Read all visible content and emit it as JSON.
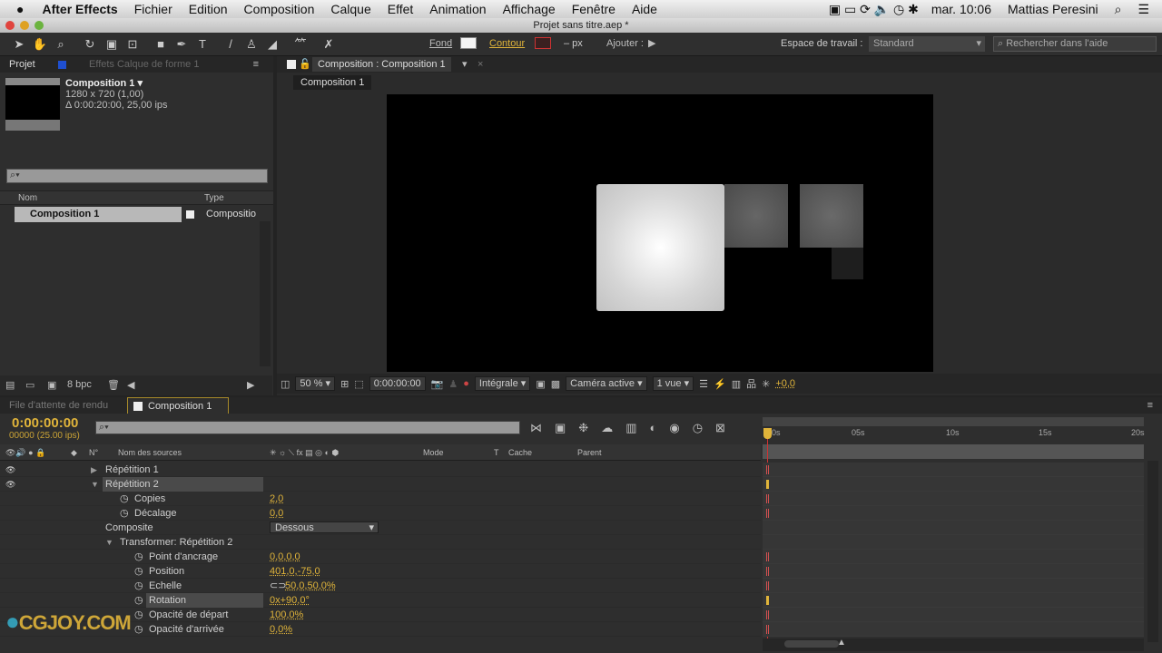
{
  "menubar": {
    "app": "After Effects",
    "items": [
      "Fichier",
      "Edition",
      "Composition",
      "Calque",
      "Effet",
      "Animation",
      "Affichage",
      "Fenêtre",
      "Aide"
    ],
    "clock": "mar. 10:06",
    "user": "Mattias Peresini"
  },
  "window": {
    "title": "Projet sans titre.aep *"
  },
  "toolbar": {
    "fond": "Fond",
    "contour": "Contour",
    "px": "– px",
    "ajouter": "Ajouter :",
    "workspace_label": "Espace de travail :",
    "workspace": "Standard",
    "help_placeholder": "Rechercher dans l'aide"
  },
  "project": {
    "tab": "Projet",
    "effects_tab": "Effets Calque de forme 1",
    "comp_name": "Composition 1 ▾",
    "comp_size": "1280 x 720 (1,00)",
    "comp_duration": "Δ 0:00:20:00, 25,00 ips",
    "col_name": "Nom",
    "col_type": "Type",
    "items": [
      {
        "name": "Composition 1",
        "type": "Compositio"
      }
    ],
    "bpc": "8 bpc"
  },
  "viewer": {
    "tab": "Composition : Composition 1",
    "breadcrumb": "Composition 1",
    "zoom": "50 %",
    "timecode": "0:00:00:00",
    "resolution": "Intégrale",
    "camera": "Caméra active",
    "views": "1 vue",
    "exposure": "+0,0"
  },
  "timeline": {
    "render_tab": "File d'attente de rendu",
    "comp_tab": "Composition 1",
    "timecode": "0:00:00:00",
    "frames": "00000 (25.00 ips)",
    "headers": {
      "num": "N°",
      "source": "Nom des sources",
      "mode": "Mode",
      "t": "T",
      "cache": "Cache",
      "parent": "Parent"
    },
    "ruler": [
      "0s",
      "05s",
      "10s",
      "15s",
      "20s"
    ],
    "rows": [
      {
        "label": "Répétition 1",
        "value": "",
        "indent": 0,
        "twirl": "right"
      },
      {
        "label": "Répétition 2",
        "value": "",
        "indent": 0,
        "twirl": "down",
        "selected": true
      },
      {
        "label": "Copies",
        "value": "2,0",
        "indent": 2,
        "stopwatch": true
      },
      {
        "label": "Décalage",
        "value": "0,0",
        "indent": 2,
        "stopwatch": true
      },
      {
        "label": "Composite",
        "value": "Dessous",
        "indent": 1,
        "dropdown": true
      },
      {
        "label": "Transformer: Répétition 2",
        "value": "",
        "indent": 1,
        "twirl": "down"
      },
      {
        "label": "Point d'ancrage",
        "value": "0,0,0,0",
        "indent": 3,
        "stopwatch": true
      },
      {
        "label": "Position",
        "value": "401,0,-75,0",
        "indent": 3,
        "stopwatch": true
      },
      {
        "label": "Echelle",
        "value": "50,0,50,0%",
        "indent": 3,
        "stopwatch": true,
        "link": true
      },
      {
        "label": "Rotation",
        "value": "0x+90,0°",
        "indent": 3,
        "stopwatch": true,
        "selected": true
      },
      {
        "label": "Opacité de départ",
        "value": "100,0%",
        "indent": 3,
        "stopwatch": true
      },
      {
        "label": "Opacité d'arrivée",
        "value": "0,0%",
        "indent": 3,
        "stopwatch": true
      }
    ]
  },
  "watermark": {
    "text": "CGJOY.COM"
  }
}
